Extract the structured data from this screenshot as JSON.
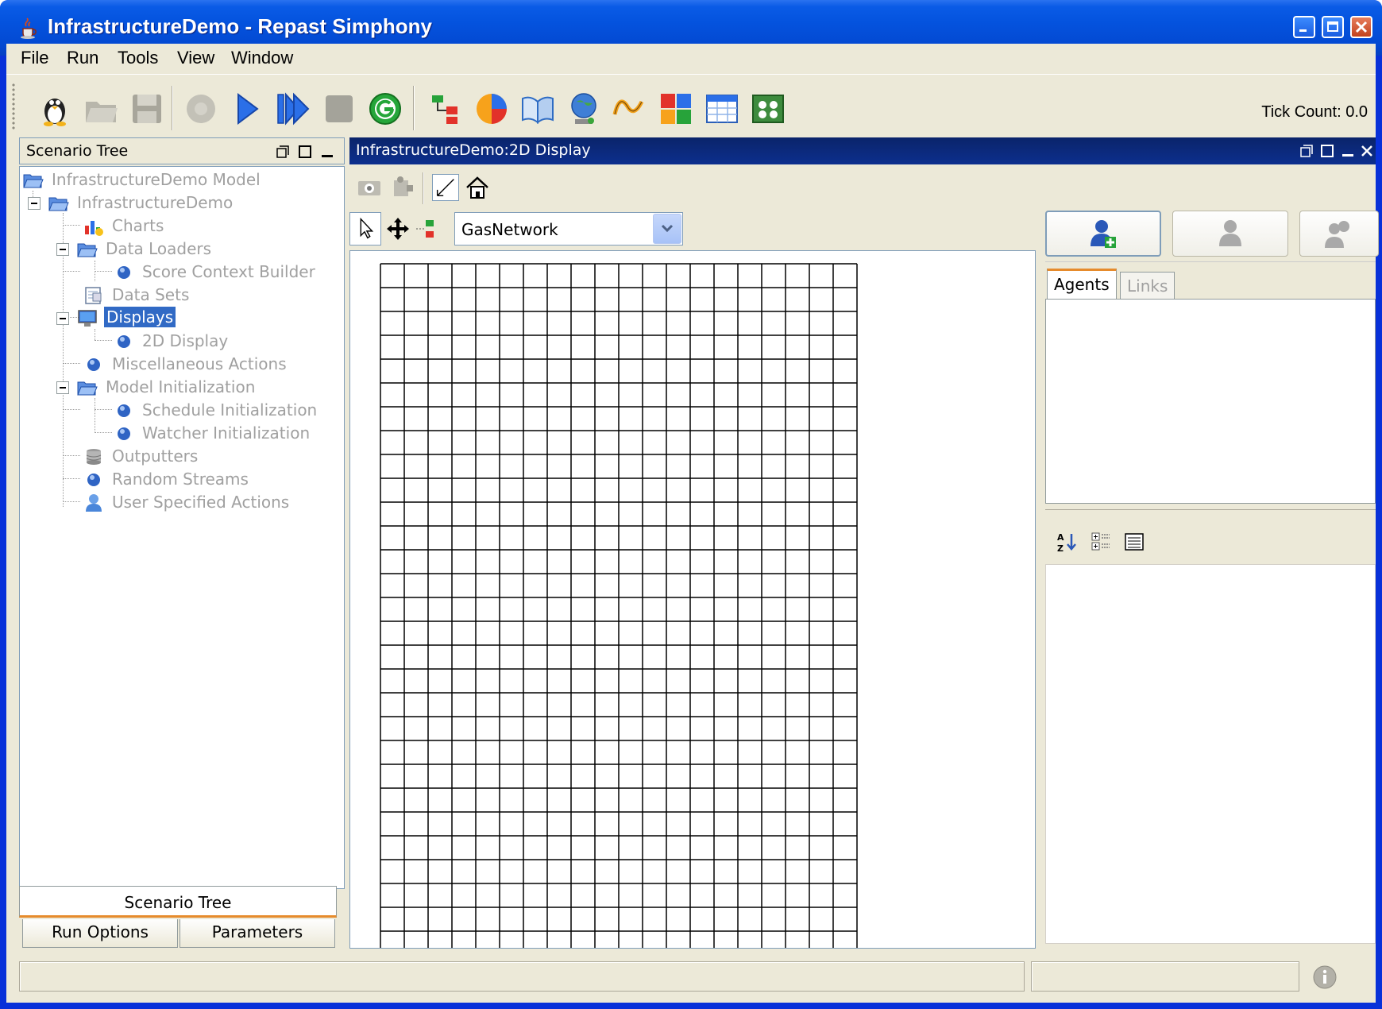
{
  "window": {
    "title": "InfrastructureDemo - Repast Simphony",
    "icon": "java-cup-icon"
  },
  "menubar": {
    "items": [
      {
        "label": "File"
      },
      {
        "label": "Run"
      },
      {
        "label": "Tools"
      },
      {
        "label": "View"
      },
      {
        "label": "Window"
      }
    ]
  },
  "toolbar": {
    "buttons": [
      "penguin-icon",
      "open-folder-icon",
      "save-icon",
      "init-icon",
      "play-icon",
      "step-icon",
      "stop-icon",
      "reset-icon",
      "model-tree-icon",
      "pie-chart-icon",
      "book-icon",
      "globe-icon",
      "wave-icon",
      "palette-icon",
      "window-icon",
      "group-icon"
    ],
    "tick_count": "Tick Count: 0.0"
  },
  "scenario_panel": {
    "title": "Scenario Tree",
    "tree": [
      {
        "label": "InfrastructureDemo Model",
        "icon": "folder-open-icon"
      },
      {
        "label": "InfrastructureDemo",
        "icon": "folder-open-icon"
      },
      {
        "label": "Charts",
        "icon": "chart-icon"
      },
      {
        "label": "Data Loaders",
        "icon": "folder-open-icon"
      },
      {
        "label": "Score Context Builder",
        "icon": "bullet-icon"
      },
      {
        "label": "Data Sets",
        "icon": "dataset-icon"
      },
      {
        "label": "Displays",
        "icon": "monitor-icon",
        "selected": true
      },
      {
        "label": "2D Display",
        "icon": "bullet-icon"
      },
      {
        "label": "Miscellaneous Actions",
        "icon": "bullet-icon"
      },
      {
        "label": "Model Initialization",
        "icon": "folder-open-icon"
      },
      {
        "label": "Schedule Initialization",
        "icon": "bullet-icon"
      },
      {
        "label": "Watcher Initialization",
        "icon": "bullet-icon"
      },
      {
        "label": "Outputters",
        "icon": "database-icon"
      },
      {
        "label": "Random Streams",
        "icon": "bullet-icon"
      },
      {
        "label": "User Specified Actions",
        "icon": "user-icon"
      }
    ],
    "tabs": {
      "scenario": "Scenario Tree",
      "run_options": "Run Options",
      "parameters": "Parameters"
    }
  },
  "display_panel": {
    "title": "InfrastructureDemo:2D Display",
    "network_select": "GasNetwork",
    "grid": {
      "columns": 20,
      "rows": 29
    }
  },
  "inspector": {
    "tabs": [
      "Agents",
      "Links"
    ],
    "active_tab": "Agents"
  },
  "colors": {
    "title_blue": "#0453de",
    "selection": "#316ac5",
    "tab_accent": "#e68b2c",
    "panel_bg": "#ece9d8"
  }
}
